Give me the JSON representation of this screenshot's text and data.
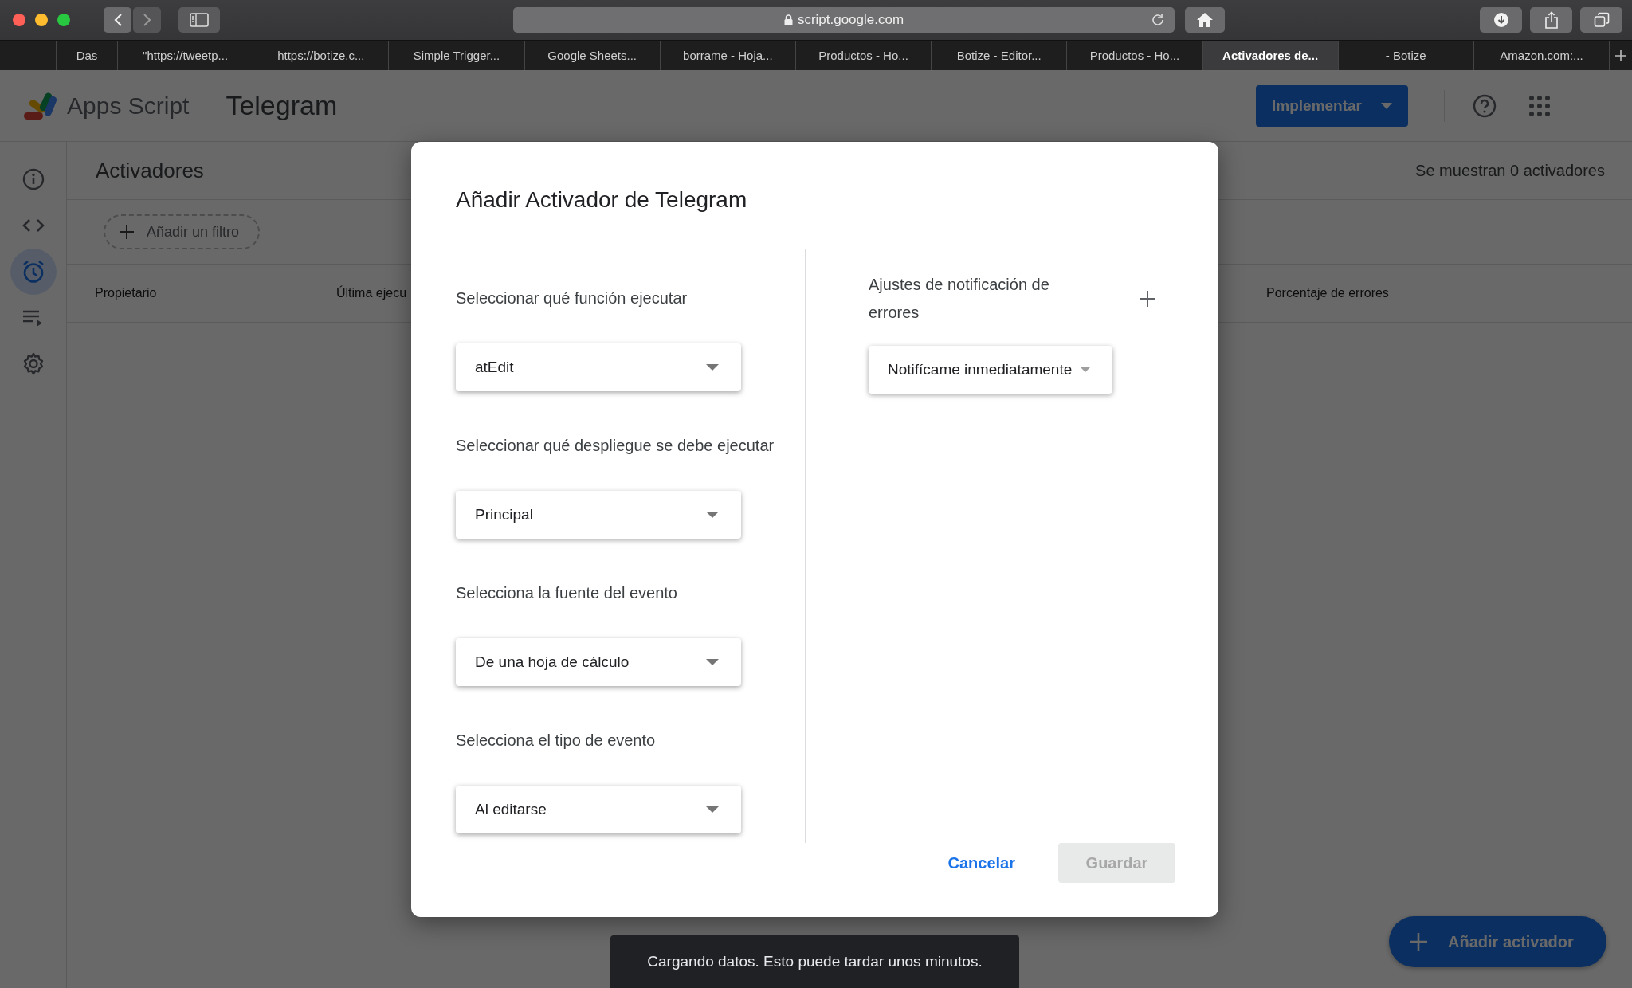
{
  "browser": {
    "url": "script.google.com",
    "tabs": [
      {
        "selected": false
      },
      {
        "selected": false
      },
      {
        "label": "Das",
        "selected": false
      },
      {
        "label": "\"https://tweetp...",
        "selected": false
      },
      {
        "label": "https://botize.c...",
        "selected": false
      },
      {
        "label": "Simple Trigger...",
        "selected": false
      },
      {
        "label": "Google Sheets...",
        "selected": false
      },
      {
        "label": "borrame - Hoja...",
        "selected": false
      },
      {
        "label": "Productos - Ho...",
        "selected": false
      },
      {
        "label": "Botize - Editor...",
        "selected": false
      },
      {
        "label": "Productos - Ho...",
        "selected": false
      },
      {
        "label": "Activadores de...",
        "selected": true
      },
      {
        "label": "- Botize",
        "selected": false
      },
      {
        "label": "Amazon.com:...",
        "selected": false
      }
    ]
  },
  "app": {
    "name": "Apps Script",
    "project": "Telegram",
    "deploy_button": "Implementar"
  },
  "sidebar": {
    "items": [
      {
        "kind": "info",
        "selected": false
      },
      {
        "kind": "code",
        "selected": false
      },
      {
        "kind": "alarm",
        "selected": true
      },
      {
        "kind": "executions",
        "selected": false
      },
      {
        "kind": "settings",
        "selected": false
      }
    ]
  },
  "page": {
    "title": "Activadores",
    "count": "Se muestran 0 activadores",
    "filter_button": "Añadir un filtro",
    "columns": [
      "Propietario",
      "Última ejecu",
      "Porcentaje de errores"
    ]
  },
  "dialog": {
    "title": "Añadir Activador de Telegram",
    "fields": [
      {
        "label": "Seleccionar qué función ejecutar",
        "value": "atEdit"
      },
      {
        "label": "Seleccionar qué despliegue se debe ejecutar",
        "value": "Principal"
      },
      {
        "label": "Selecciona la fuente del evento",
        "value": "De una hoja de cálculo"
      },
      {
        "label": "Selecciona el tipo de evento",
        "value": "Al editarse"
      }
    ],
    "notification": {
      "label": "Ajustes de notificación de errores",
      "value": "Notifícame inmediatamente"
    },
    "buttons": [
      {
        "label": "Cancelar",
        "kind": "text",
        "disabled": false
      },
      {
        "label": "Guardar",
        "kind": "filled",
        "disabled": true
      }
    ]
  },
  "toast": "Cargando datos. Esto puede tardar unos minutos.",
  "fab": "Añadir activador"
}
